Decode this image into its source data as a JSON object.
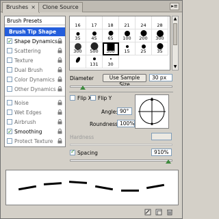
{
  "tabs": [
    {
      "label": "Brushes",
      "close": "×",
      "active": true
    },
    {
      "label": "Clone Source",
      "active": false
    }
  ],
  "panel_menu_icon": "menu-triangle-icon",
  "list": {
    "header": "Brush Presets",
    "items": [
      {
        "label": "Brush Tip Shape",
        "selected": true,
        "checkbox": false,
        "dim": false
      },
      {
        "label": "Shape Dynamics",
        "checked": true,
        "lock": true
      },
      {
        "label": "Scattering",
        "checked": false,
        "lock": true
      },
      {
        "label": "Texture",
        "checked": false,
        "lock": true
      },
      {
        "label": "Dual Brush",
        "checked": false,
        "lock": true
      },
      {
        "label": "Color Dynamics",
        "checked": false,
        "lock": true
      },
      {
        "label": "Other Dynamics",
        "checked": false,
        "lock": true
      },
      {
        "label": "Noise",
        "checked": false,
        "lock": true
      },
      {
        "label": "Wet Edges",
        "checked": false,
        "lock": true
      },
      {
        "label": "Airbrush",
        "checked": false,
        "lock": true
      },
      {
        "label": "Smoothing",
        "checked": true,
        "lock": true
      },
      {
        "label": "Protect Texture",
        "checked": false,
        "lock": true
      }
    ]
  },
  "brush_grid": {
    "rows": [
      [
        "16",
        "17",
        "18",
        "21",
        "24",
        "28"
      ],
      [
        "35",
        "45",
        "65",
        "100",
        "200",
        "300"
      ],
      [
        "300",
        "500",
        "300",
        "15",
        "25",
        "35"
      ],
      [
        "",
        "131",
        "30",
        "",
        "",
        ""
      ]
    ],
    "selected": "15"
  },
  "diameter": {
    "label": "Diameter",
    "button": "Use Sample Size",
    "value": "30 px",
    "slider_fraction": 0.12
  },
  "flip_x": {
    "label": "Flip X",
    "checked": false
  },
  "flip_y": {
    "label": "Flip Y",
    "checked": false
  },
  "angle": {
    "label": "Angle:",
    "value": "90°"
  },
  "roundness": {
    "label": "Roundness:",
    "value": "100%"
  },
  "hardness": {
    "label": "Hardness",
    "value": ""
  },
  "spacing": {
    "label": "Spacing",
    "checked": true,
    "value": "910%",
    "slider_fraction": 0.95
  },
  "bottom_icons": [
    "brush-preview-icon",
    "new-preset-icon",
    "trash-icon"
  ]
}
